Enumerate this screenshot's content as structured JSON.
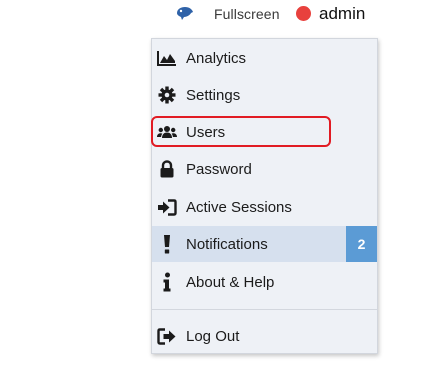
{
  "topbar": {
    "status_icon": "bird-icon",
    "fullscreen_label": "Fullscreen",
    "status_color": "#e8413d",
    "user_label": "admin"
  },
  "menu": {
    "items": [
      {
        "label": "Analytics",
        "icon": "area-chart-icon"
      },
      {
        "label": "Settings",
        "icon": "gear-icon"
      },
      {
        "label": "Users",
        "icon": "users-icon"
      },
      {
        "label": "Password",
        "icon": "lock-icon"
      },
      {
        "label": "Active Sessions",
        "icon": "sign-in-icon"
      },
      {
        "label": "Notifications",
        "icon": "exclamation-icon",
        "badge": "2"
      },
      {
        "label": "About & Help",
        "icon": "info-icon"
      },
      {
        "label": "Log Out",
        "icon": "sign-out-icon"
      }
    ]
  },
  "colors": {
    "menu_background": "#eef1f6",
    "highlight_row": "#d6e0ee",
    "badge": "#5b9bd5",
    "focus_ring": "#e11b23"
  }
}
